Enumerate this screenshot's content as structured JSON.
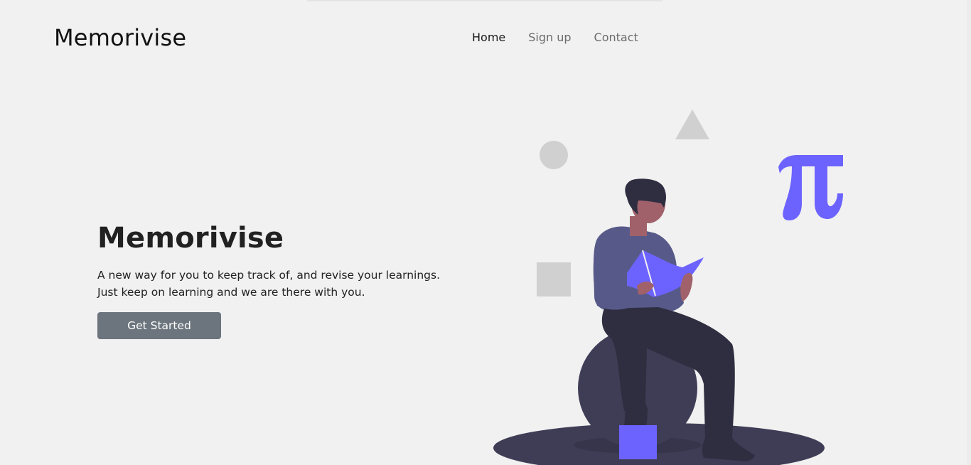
{
  "brand": {
    "name": "Memorivise"
  },
  "nav": {
    "items": [
      {
        "label": "Home",
        "active": true
      },
      {
        "label": "Sign up",
        "active": false
      },
      {
        "label": "Contact",
        "active": false
      }
    ]
  },
  "hero": {
    "title": "Memorivise",
    "line1": "A new way for you to keep track of, and revise your learnings.",
    "line2": "Just keep on learning and we are there with you.",
    "cta_label": "Get Started"
  },
  "illustration": {
    "pi_glyph": "π",
    "colors": {
      "accent": "#6c63ff",
      "dark": "#3f3d56",
      "shape_gray": "#d0d0d0",
      "skin": "#a0616a",
      "hair": "#2f2e41",
      "shirt": "#575a89",
      "pants": "#2f2e41"
    }
  }
}
